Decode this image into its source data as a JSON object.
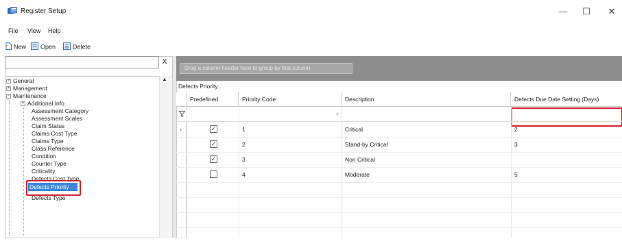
{
  "window": {
    "title": "Register Setup",
    "minimize": "—",
    "maximize": "☐",
    "close": "✕"
  },
  "menu": {
    "items": [
      "File",
      "View",
      "Help"
    ]
  },
  "toolbar": {
    "new_label": "New",
    "open_label": "Open",
    "delete_label": "Delete"
  },
  "search": {
    "value": "",
    "clear": "X"
  },
  "tree": {
    "items": [
      {
        "label": "General",
        "expander": "+",
        "level": 0
      },
      {
        "label": "Management",
        "expander": "+",
        "level": 0
      },
      {
        "label": "Maintenance",
        "expander": "−",
        "level": 0
      },
      {
        "label": "Additional Info",
        "expander": "+",
        "level": 1
      },
      {
        "label": "Assessment Category",
        "level": 2
      },
      {
        "label": "Assessment Scales",
        "level": 2
      },
      {
        "label": "Claim Status",
        "level": 2
      },
      {
        "label": "Claims Cost Type",
        "level": 2
      },
      {
        "label": "Claims Type",
        "level": 2
      },
      {
        "label": "Class Reference",
        "level": 2
      },
      {
        "label": "Condition",
        "level": 2
      },
      {
        "label": "Counter Type",
        "level": 2
      },
      {
        "label": "Criticality",
        "level": 2
      },
      {
        "label": "Defects Cost Type",
        "level": 2
      },
      {
        "label": "Defects Priority",
        "level": 2,
        "selected": true
      },
      {
        "label": "Defects Type",
        "level": 2
      }
    ]
  },
  "grid": {
    "group_hint": "Drag a column header here to group by that column",
    "caption": "Defects Priority",
    "columns": [
      "Predefined",
      "Priority Code",
      "Description",
      "Defects Due Date Setting (Days)"
    ],
    "rows": [
      {
        "predefined": true,
        "code": "1",
        "description": "Critical",
        "due_days": "2"
      },
      {
        "predefined": true,
        "code": "2",
        "description": "Stand-by Critical",
        "due_days": "3"
      },
      {
        "predefined": true,
        "code": "3",
        "description": "Non Critical",
        "due_days": ""
      },
      {
        "predefined": false,
        "code": "4",
        "description": "Moderate",
        "due_days": "5"
      }
    ],
    "current_row_marker": "›"
  },
  "colors": {
    "highlight": "#d4202e",
    "selection": "#3b86d8",
    "group_bar": "#8d8d8d"
  }
}
